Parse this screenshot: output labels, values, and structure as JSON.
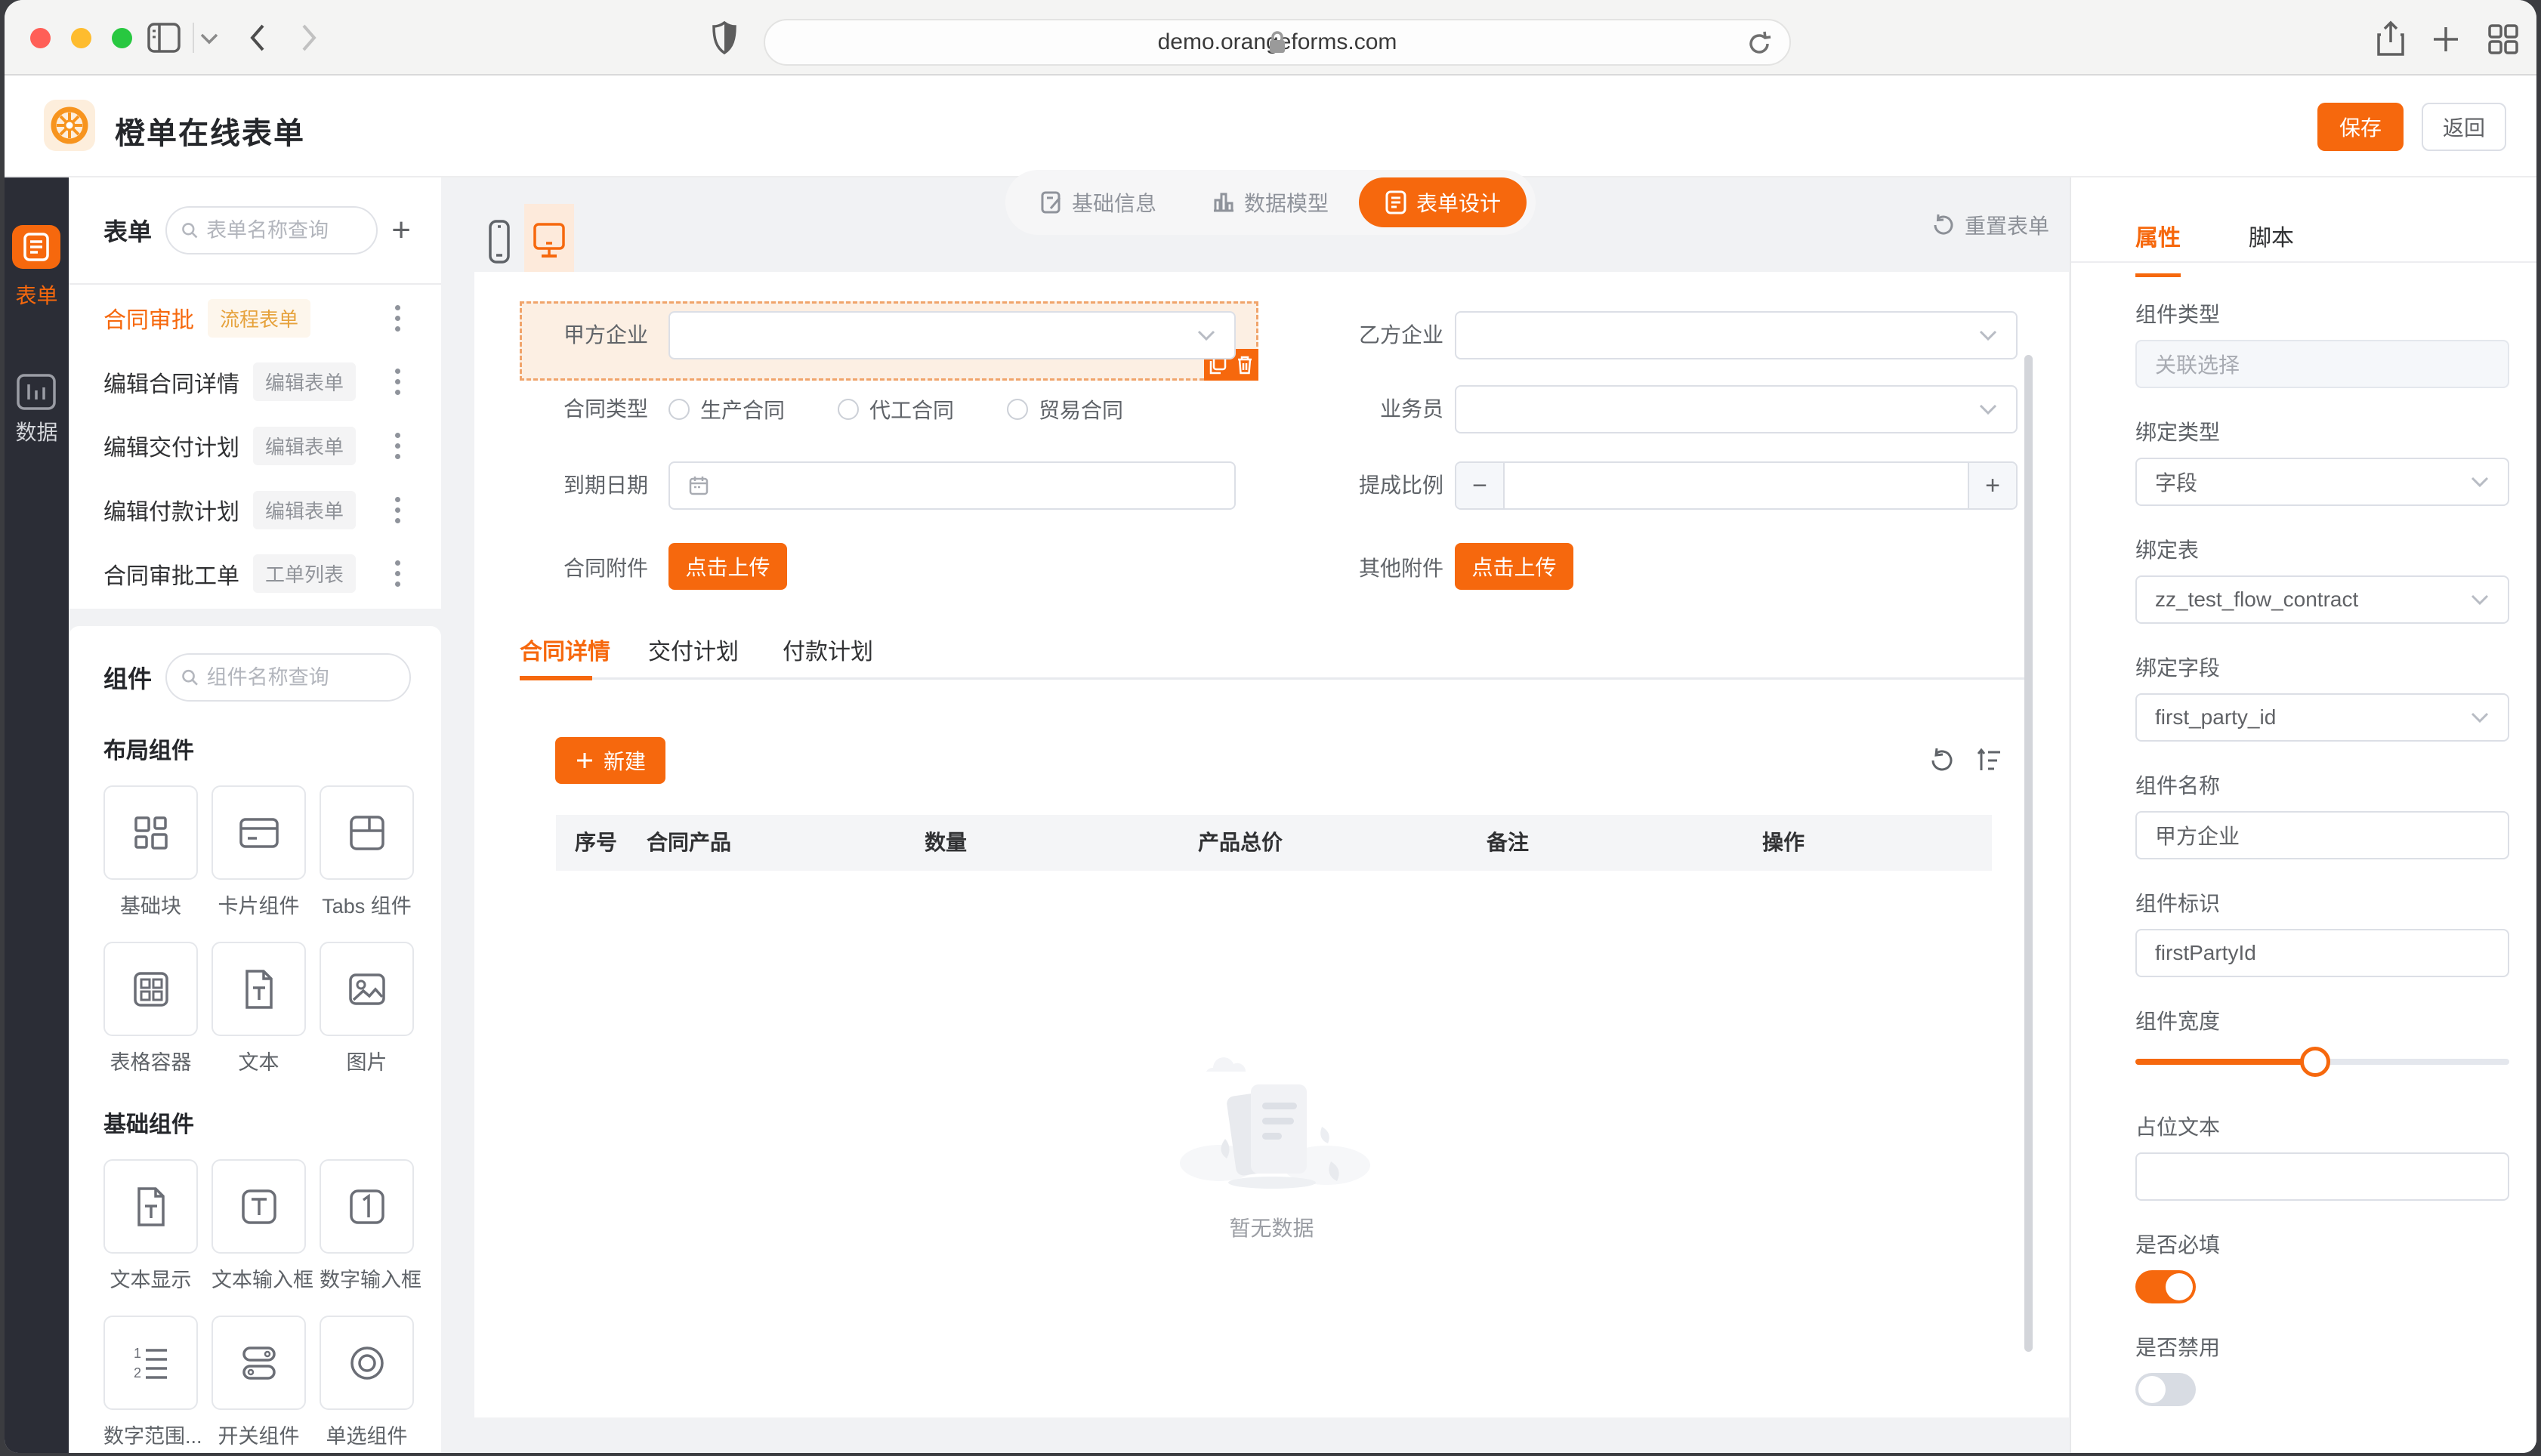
{
  "browser": {
    "url": "demo.orangeforms.com"
  },
  "header": {
    "app_title": "橙单在线表单",
    "nav": [
      {
        "label": "基础信息"
      },
      {
        "label": "数据模型"
      },
      {
        "label": "表单设计"
      }
    ],
    "save_label": "保存",
    "back_label": "返回"
  },
  "rail": {
    "items": [
      {
        "label": "表单"
      },
      {
        "label": "数据"
      }
    ]
  },
  "forms_panel": {
    "title": "表单",
    "search_placeholder": "表单名称查询",
    "items": [
      {
        "name": "合同审批",
        "badge": "流程表单"
      },
      {
        "name": "编辑合同详情",
        "badge": "编辑表单"
      },
      {
        "name": "编辑交付计划",
        "badge": "编辑表单"
      },
      {
        "name": "编辑付款计划",
        "badge": "编辑表单"
      },
      {
        "name": "合同审批工单",
        "badge": "工单列表"
      }
    ]
  },
  "components_panel": {
    "title": "组件",
    "search_placeholder": "组件名称查询",
    "sections": [
      {
        "title": "布局组件",
        "items": [
          {
            "label": "基础块"
          },
          {
            "label": "卡片组件"
          },
          {
            "label": "Tabs 组件"
          },
          {
            "label": "表格容器"
          },
          {
            "label": "文本"
          },
          {
            "label": "图片"
          }
        ]
      },
      {
        "title": "基础组件",
        "items": [
          {
            "label": "文本显示"
          },
          {
            "label": "文本输入框"
          },
          {
            "label": "数字输入框"
          },
          {
            "label": "数字范围..."
          },
          {
            "label": "开关组件"
          },
          {
            "label": "单选组件"
          }
        ]
      }
    ]
  },
  "canvas": {
    "reset_label": "重置表单",
    "fields": {
      "first_party": {
        "label": "甲方企业"
      },
      "second_party": {
        "label": "乙方企业"
      },
      "contract_type": {
        "label": "合同类型",
        "options": [
          "生产合同",
          "代工合同",
          "贸易合同"
        ]
      },
      "salesman": {
        "label": "业务员"
      },
      "due_date": {
        "label": "到期日期"
      },
      "commission": {
        "label": "提成比例"
      },
      "contract_attachment": {
        "label": "合同附件",
        "button": "点击上传"
      },
      "other_attachment": {
        "label": "其他附件",
        "button": "点击上传"
      }
    },
    "tabs": [
      {
        "label": "合同详情"
      },
      {
        "label": "交付计划"
      },
      {
        "label": "付款计划"
      }
    ],
    "new_button": "新建",
    "table": {
      "columns": [
        "序号",
        "合同产品",
        "数量",
        "产品总价",
        "备注",
        "操作"
      ]
    },
    "empty_text": "暂无数据"
  },
  "props_panel": {
    "tabs": [
      {
        "label": "属性"
      },
      {
        "label": "脚本"
      }
    ],
    "groups": {
      "component_type": {
        "label": "组件类型",
        "placeholder": "关联选择"
      },
      "bind_type": {
        "label": "绑定类型",
        "value": "字段"
      },
      "bind_table": {
        "label": "绑定表",
        "value": "zz_test_flow_contract"
      },
      "bind_field": {
        "label": "绑定字段",
        "value": "first_party_id"
      },
      "component_name": {
        "label": "组件名称",
        "value": "甲方企业"
      },
      "component_key": {
        "label": "组件标识",
        "value": "firstPartyId"
      },
      "component_width": {
        "label": "组件宽度",
        "percent": 48
      },
      "placeholder_text": {
        "label": "占位文本",
        "value": ""
      },
      "required": {
        "label": "是否必填",
        "state": "on"
      },
      "disabled": {
        "label": "是否禁用",
        "state": "off"
      }
    }
  },
  "colors": {
    "primary": "#f6680d",
    "primary_light": "#fdeadb",
    "warning_text": "#e6a23c",
    "warning_bg": "#fdf6ec",
    "info_text": "#909399",
    "info_bg": "#f4f4f5",
    "rail_bg": "#2b2d36"
  }
}
